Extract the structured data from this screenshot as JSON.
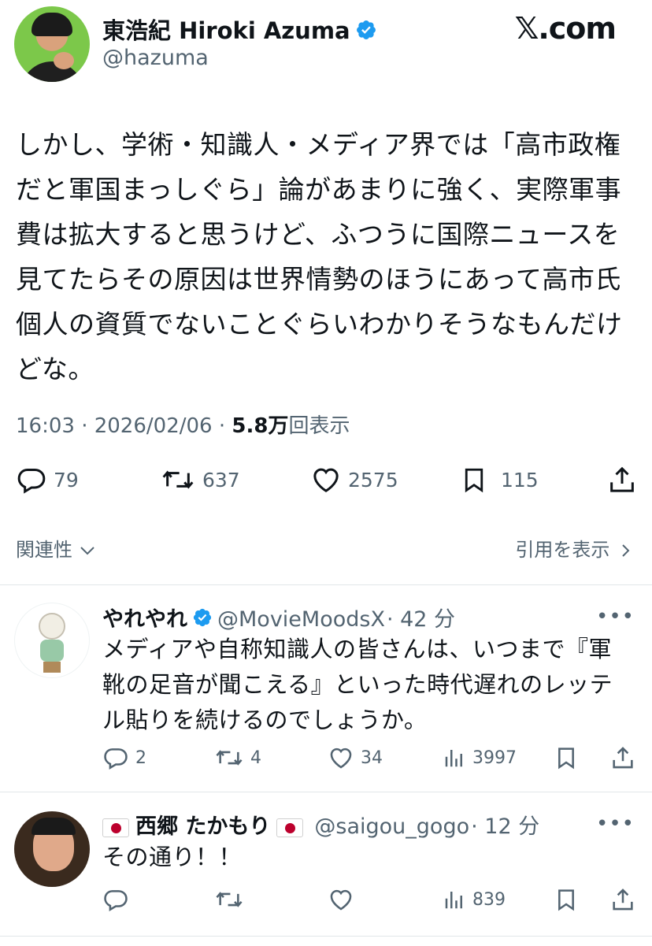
{
  "tweet": {
    "author_name": "東浩紀 Hiroki Azuma",
    "handle": "@hazuma",
    "brand": "𝕏.com",
    "text_lines": [
      "しかし、学術・知識人・メディア界では「高市政権",
      "だと軍国まっしぐら」論があまりに強く、実際軍事",
      "費は拡大すると思うけど、ふつうに国際ニュースを",
      "見てたらその原因は世界情勢のほうにあって高市氏",
      "個人の資質でないことぐらいわかりそうなもんだけ",
      "どな。"
    ],
    "time": "16:03 · 2026/02/06 · ",
    "views": "5.8万",
    "views_label": "回表示",
    "counts": {
      "replies": "79",
      "reposts": "637",
      "likes": "2575",
      "bookmarks": "115"
    }
  },
  "nav": {
    "related": "関連性",
    "quotes": "引用を表示"
  },
  "replies": [
    {
      "name": "やれやれ",
      "handle": "@MovieMoodsX",
      "time": "· 42 分",
      "text_lines": [
        "メディアや自称知識人の皆さんは、いつまで『軍",
        "靴の足音が聞こえる』といった時代遅れのレッテ",
        "ル貼りを続けるのでしょうか。"
      ],
      "counts": {
        "replies": "2",
        "reposts": "4",
        "likes": "34",
        "views": "3997"
      }
    },
    {
      "name": "西郷 たかもり",
      "handle": "@saigou_gogo",
      "time": "· 12 分",
      "text_lines": [
        "その通り！！"
      ],
      "counts": {
        "views": "839"
      }
    }
  ],
  "colors": {
    "text": "#0f1419",
    "secondary": "#536471",
    "verified": "#1d9bf0",
    "divider": "#e2e6e9"
  }
}
